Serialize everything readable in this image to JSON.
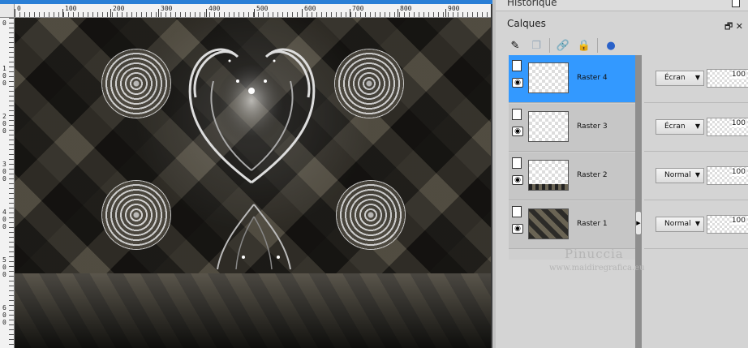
{
  "rulers": {
    "top_labels": [
      "0",
      "100",
      "200",
      "300",
      "400",
      "500",
      "600",
      "700",
      "800",
      "900"
    ],
    "left_labels": [
      "0",
      "100",
      "200",
      "300",
      "400",
      "500",
      "600"
    ]
  },
  "panel": {
    "history_title": "Historique",
    "layers_title": "Calques",
    "head_icons": "🗗 ✕"
  },
  "layers": [
    {
      "name": "Raster 4",
      "blend": "Écran",
      "opacity": "100",
      "selected": true
    },
    {
      "name": "Raster 3",
      "blend": "Écran",
      "opacity": "100",
      "selected": false
    },
    {
      "name": "Raster 2",
      "blend": "Normal",
      "opacity": "100",
      "selected": false
    },
    {
      "name": "Raster 1",
      "blend": "Normal",
      "opacity": "100",
      "selected": false
    }
  ],
  "watermark": {
    "name": "Pinuccia",
    "url": "www.maidiregrafica.eu"
  },
  "colors": {
    "selection": "#3399ff"
  }
}
